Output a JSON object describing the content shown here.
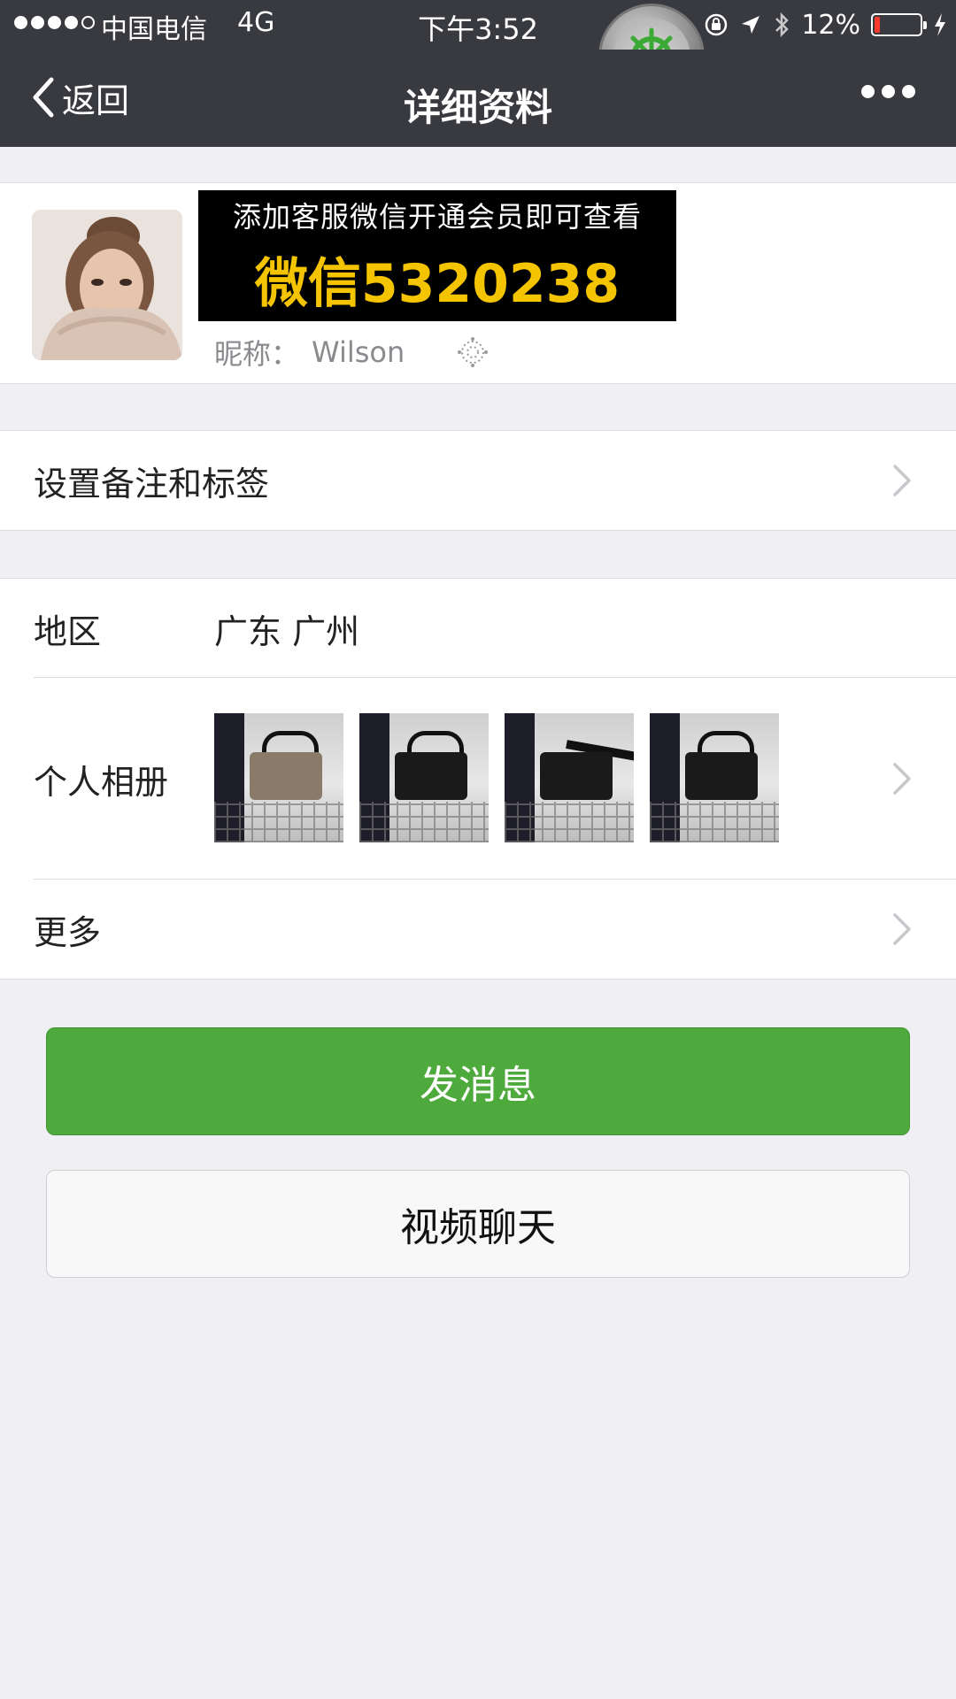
{
  "status_bar": {
    "carrier": "中国电信",
    "network": "4G",
    "time": "下午3:52",
    "battery_percent": "12%",
    "battery_level": 0.12,
    "battery_color": "#ff3b30",
    "signal_bars_filled": 4,
    "signal_bars_total": 5,
    "icons": [
      "rotation-lock-icon",
      "location-arrow-icon",
      "bluetooth-icon",
      "battery-icon",
      "charging-bolt-icon"
    ]
  },
  "overlay": {
    "icon": "ship-wheel-icon",
    "color": "#3aa935"
  },
  "nav": {
    "back_label": "返回",
    "title": "详细资料",
    "more_icon": "more-dots-icon"
  },
  "profile": {
    "ad_line1": "添加客服微信开通会员即可查看",
    "ad_line2": "微信5320238",
    "nickname_label": "昵称：",
    "nickname_value": "Wilson",
    "gender_icon": "gender-icon"
  },
  "cells": {
    "remark_label": "设置备注和标签",
    "region_label": "地区",
    "region_value": "广东 广州",
    "album_label": "个人相册",
    "album_thumb_count": 4,
    "more_label": "更多"
  },
  "actions": {
    "send_message": "发消息",
    "video_chat": "视频聊天",
    "primary_color": "#4faa3e"
  }
}
